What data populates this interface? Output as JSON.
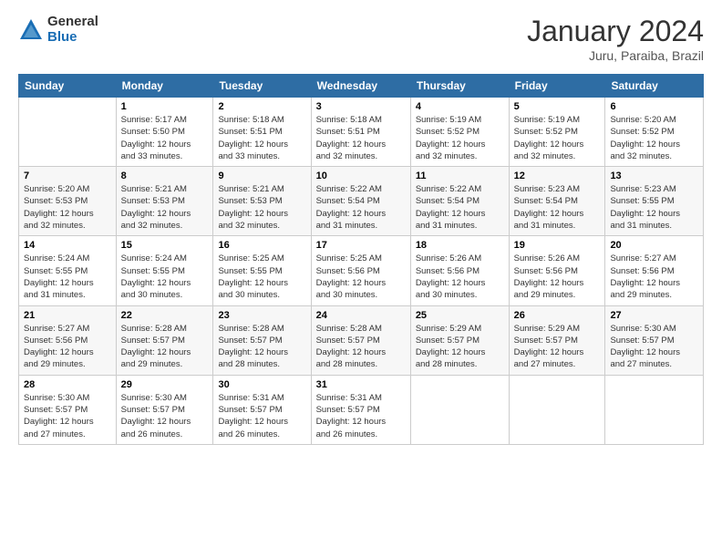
{
  "logo": {
    "general": "General",
    "blue": "Blue"
  },
  "header": {
    "month": "January 2024",
    "location": "Juru, Paraiba, Brazil"
  },
  "days_of_week": [
    "Sunday",
    "Monday",
    "Tuesday",
    "Wednesday",
    "Thursday",
    "Friday",
    "Saturday"
  ],
  "weeks": [
    [
      {
        "day": "",
        "info": ""
      },
      {
        "day": "1",
        "info": "Sunrise: 5:17 AM\nSunset: 5:50 PM\nDaylight: 12 hours\nand 33 minutes."
      },
      {
        "day": "2",
        "info": "Sunrise: 5:18 AM\nSunset: 5:51 PM\nDaylight: 12 hours\nand 33 minutes."
      },
      {
        "day": "3",
        "info": "Sunrise: 5:18 AM\nSunset: 5:51 PM\nDaylight: 12 hours\nand 32 minutes."
      },
      {
        "day": "4",
        "info": "Sunrise: 5:19 AM\nSunset: 5:52 PM\nDaylight: 12 hours\nand 32 minutes."
      },
      {
        "day": "5",
        "info": "Sunrise: 5:19 AM\nSunset: 5:52 PM\nDaylight: 12 hours\nand 32 minutes."
      },
      {
        "day": "6",
        "info": "Sunrise: 5:20 AM\nSunset: 5:52 PM\nDaylight: 12 hours\nand 32 minutes."
      }
    ],
    [
      {
        "day": "7",
        "info": "Sunrise: 5:20 AM\nSunset: 5:53 PM\nDaylight: 12 hours\nand 32 minutes."
      },
      {
        "day": "8",
        "info": "Sunrise: 5:21 AM\nSunset: 5:53 PM\nDaylight: 12 hours\nand 32 minutes."
      },
      {
        "day": "9",
        "info": "Sunrise: 5:21 AM\nSunset: 5:53 PM\nDaylight: 12 hours\nand 32 minutes."
      },
      {
        "day": "10",
        "info": "Sunrise: 5:22 AM\nSunset: 5:54 PM\nDaylight: 12 hours\nand 31 minutes."
      },
      {
        "day": "11",
        "info": "Sunrise: 5:22 AM\nSunset: 5:54 PM\nDaylight: 12 hours\nand 31 minutes."
      },
      {
        "day": "12",
        "info": "Sunrise: 5:23 AM\nSunset: 5:54 PM\nDaylight: 12 hours\nand 31 minutes."
      },
      {
        "day": "13",
        "info": "Sunrise: 5:23 AM\nSunset: 5:55 PM\nDaylight: 12 hours\nand 31 minutes."
      }
    ],
    [
      {
        "day": "14",
        "info": "Sunrise: 5:24 AM\nSunset: 5:55 PM\nDaylight: 12 hours\nand 31 minutes."
      },
      {
        "day": "15",
        "info": "Sunrise: 5:24 AM\nSunset: 5:55 PM\nDaylight: 12 hours\nand 30 minutes."
      },
      {
        "day": "16",
        "info": "Sunrise: 5:25 AM\nSunset: 5:55 PM\nDaylight: 12 hours\nand 30 minutes."
      },
      {
        "day": "17",
        "info": "Sunrise: 5:25 AM\nSunset: 5:56 PM\nDaylight: 12 hours\nand 30 minutes."
      },
      {
        "day": "18",
        "info": "Sunrise: 5:26 AM\nSunset: 5:56 PM\nDaylight: 12 hours\nand 30 minutes."
      },
      {
        "day": "19",
        "info": "Sunrise: 5:26 AM\nSunset: 5:56 PM\nDaylight: 12 hours\nand 29 minutes."
      },
      {
        "day": "20",
        "info": "Sunrise: 5:27 AM\nSunset: 5:56 PM\nDaylight: 12 hours\nand 29 minutes."
      }
    ],
    [
      {
        "day": "21",
        "info": "Sunrise: 5:27 AM\nSunset: 5:56 PM\nDaylight: 12 hours\nand 29 minutes."
      },
      {
        "day": "22",
        "info": "Sunrise: 5:28 AM\nSunset: 5:57 PM\nDaylight: 12 hours\nand 29 minutes."
      },
      {
        "day": "23",
        "info": "Sunrise: 5:28 AM\nSunset: 5:57 PM\nDaylight: 12 hours\nand 28 minutes."
      },
      {
        "day": "24",
        "info": "Sunrise: 5:28 AM\nSunset: 5:57 PM\nDaylight: 12 hours\nand 28 minutes."
      },
      {
        "day": "25",
        "info": "Sunrise: 5:29 AM\nSunset: 5:57 PM\nDaylight: 12 hours\nand 28 minutes."
      },
      {
        "day": "26",
        "info": "Sunrise: 5:29 AM\nSunset: 5:57 PM\nDaylight: 12 hours\nand 27 minutes."
      },
      {
        "day": "27",
        "info": "Sunrise: 5:30 AM\nSunset: 5:57 PM\nDaylight: 12 hours\nand 27 minutes."
      }
    ],
    [
      {
        "day": "28",
        "info": "Sunrise: 5:30 AM\nSunset: 5:57 PM\nDaylight: 12 hours\nand 27 minutes."
      },
      {
        "day": "29",
        "info": "Sunrise: 5:30 AM\nSunset: 5:57 PM\nDaylight: 12 hours\nand 26 minutes."
      },
      {
        "day": "30",
        "info": "Sunrise: 5:31 AM\nSunset: 5:57 PM\nDaylight: 12 hours\nand 26 minutes."
      },
      {
        "day": "31",
        "info": "Sunrise: 5:31 AM\nSunset: 5:57 PM\nDaylight: 12 hours\nand 26 minutes."
      },
      {
        "day": "",
        "info": ""
      },
      {
        "day": "",
        "info": ""
      },
      {
        "day": "",
        "info": ""
      }
    ]
  ]
}
